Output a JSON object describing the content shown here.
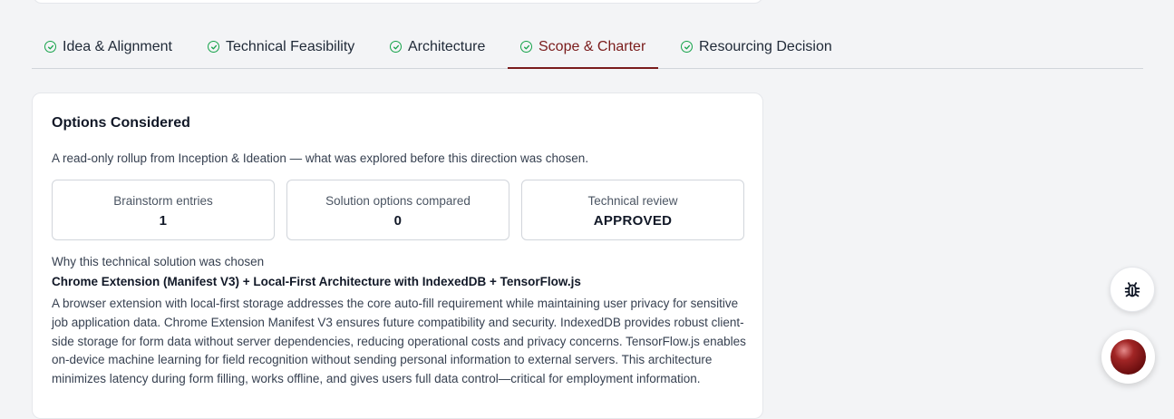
{
  "tabs": [
    {
      "label": "Idea & Alignment"
    },
    {
      "label": "Technical Feasibility"
    },
    {
      "label": "Architecture"
    },
    {
      "label": "Scope & Charter",
      "active": true
    },
    {
      "label": "Resourcing Decision"
    }
  ],
  "options": {
    "title": "Options Considered",
    "subtitle": "A read-only rollup from Inception & Ideation — what was explored before this direction was chosen.",
    "stats": [
      {
        "label": "Brainstorm entries",
        "value": "1"
      },
      {
        "label": "Solution options compared",
        "value": "0"
      },
      {
        "label": "Technical review",
        "value": "APPROVED"
      }
    ],
    "why_label": "Why this technical solution was chosen",
    "solution_title": "Chrome Extension (Manifest V3) + Local-First Architecture with IndexedDB + TensorFlow.js",
    "solution_body": "A browser extension with local-first storage addresses the core auto-fill requirement while maintaining user privacy for sensitive job application data. Chrome Extension Manifest V3 ensures future compatibility and security. IndexedDB provides robust client-side storage for form data without server dependencies, reducing operational costs and privacy concerns. TensorFlow.js enables on-device machine learning for field recognition without sending personal information to external servers. This architecture minimizes latency during form filling, works offline, and gives users full data control—critical for employment information."
  },
  "colors": {
    "accent": "#7a1c1c",
    "check": "#16a34a"
  },
  "icons": {
    "tab_status": "check-circle-icon",
    "bug": "bug-icon",
    "record": "record-icon"
  }
}
